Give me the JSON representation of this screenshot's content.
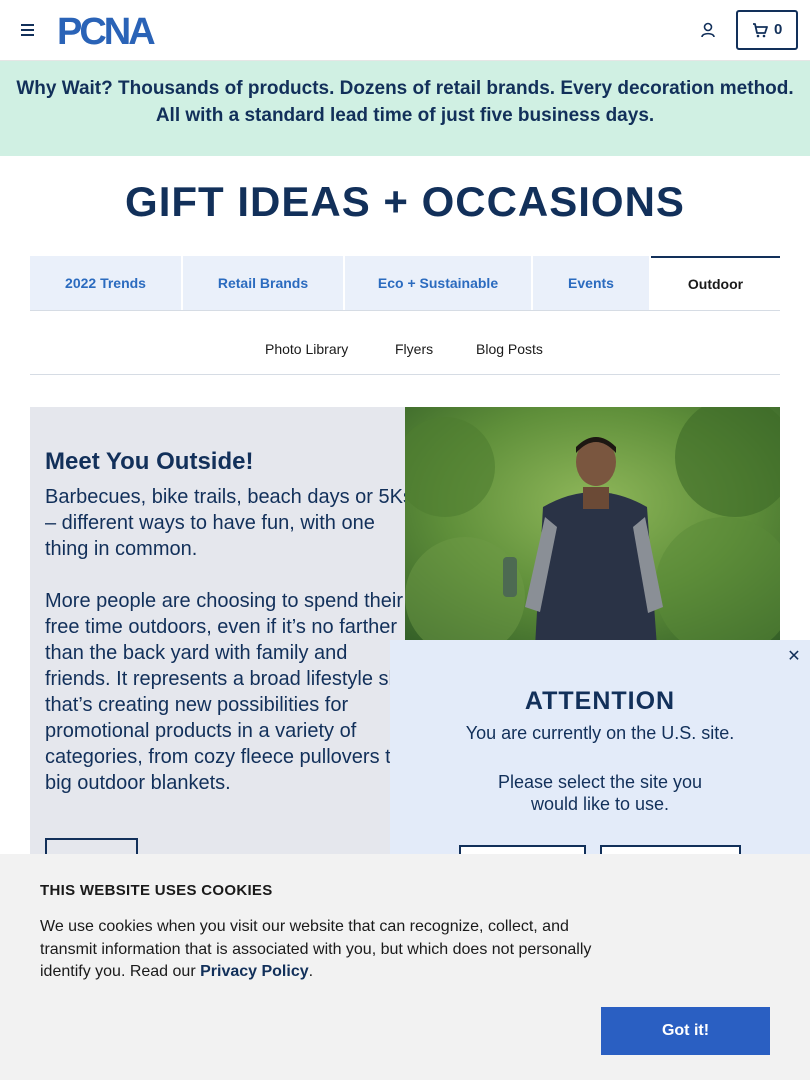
{
  "header": {
    "logo_text": "PCNA",
    "cart_count": "0"
  },
  "promo": {
    "lead": "Why Wait?",
    "text": " Thousands of products. Dozens of retail brands. Every decoration method. All with a standard lead time of just five business days."
  },
  "page_title": "GIFT IDEAS + OCCASIONS",
  "tabs": [
    {
      "label": "2022 Trends"
    },
    {
      "label": "Retail Brands"
    },
    {
      "label": "Eco + Sustainable"
    },
    {
      "label": "Events"
    },
    {
      "label": "Outdoor",
      "active": true
    }
  ],
  "subtabs": [
    {
      "label": "Photo Library"
    },
    {
      "label": "Flyers"
    },
    {
      "label": "Blog Posts"
    }
  ],
  "feature": {
    "title": "Meet You Outside!",
    "paragraph1": "Barbecues, bike trails, beach days or 5Ks – different ways to have fun, with one thing in common.",
    "paragraph2": "More people are choosing to spend their free time outdoors, even if it’s no farther than the back yard with family and friends. It represents a broad lifestyle shift that’s creating new possibilities for promotional products in a variety of categories, from cozy fleece pullovers to big outdoor blankets."
  },
  "attention": {
    "title": "ATTENTION",
    "line1": "You are currently on the U.S. site.",
    "line2": "Please select the site you would like to use."
  },
  "cookie": {
    "title": "THIS WEBSITE USES COOKIES",
    "text": "We use cookies when you visit our website that can recognize, collect, and transmit information that is associated with you, but which does not personally identify you. Read our ",
    "link": "Privacy Policy",
    "text_end": ".",
    "button": "Got it!"
  },
  "colors": {
    "navy": "#12305a",
    "mint": "#d0f0e3",
    "accent_blue": "#2a5fc2"
  }
}
